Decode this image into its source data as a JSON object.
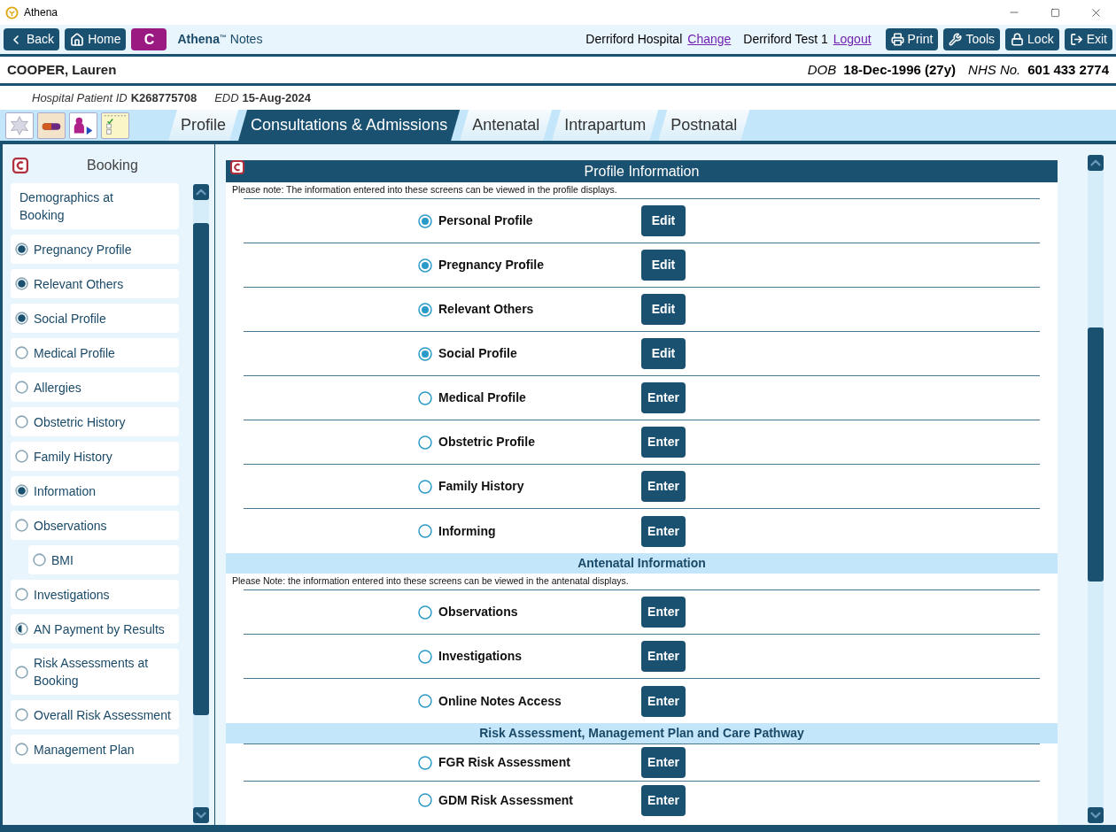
{
  "window": {
    "title": "Athena"
  },
  "toolbar": {
    "left_buttons": [
      {
        "kind": "back",
        "label": "Back"
      },
      {
        "kind": "home",
        "label": "Home"
      },
      {
        "kind": "badge",
        "label": "C"
      }
    ],
    "app_name": "Athena",
    "app_mark": "™",
    "app_suffix": "Notes",
    "hospital": "Derriford Hospital",
    "change_link": "Change",
    "user": "Derriford Test 1",
    "logout_link": "Logout",
    "right_buttons": [
      {
        "kind": "print",
        "label": "Print"
      },
      {
        "kind": "tools",
        "label": "Tools"
      },
      {
        "kind": "lock",
        "label": "Lock"
      },
      {
        "kind": "exit",
        "label": "Exit"
      }
    ]
  },
  "patient": {
    "name": "COOPER, Lauren",
    "dob_label": "DOB",
    "dob": "18-Dec-1996 (27y)",
    "nhs_label": "NHS No.",
    "nhs": "601 433 2774",
    "id_label": "Hospital Patient ID",
    "id": "K268775708",
    "edd_label": "EDD",
    "edd": "15-Aug-2024"
  },
  "tool_icons": [
    {
      "kind": "star"
    },
    {
      "kind": "pill"
    },
    {
      "kind": "person"
    },
    {
      "kind": "note"
    }
  ],
  "tabs": [
    {
      "label": "Profile",
      "selected": false
    },
    {
      "label": "Consultations & Admissions",
      "selected": true
    },
    {
      "label": "Antenatal",
      "selected": false
    },
    {
      "label": "Intrapartum",
      "selected": false
    },
    {
      "label": "Postnatal",
      "selected": false
    }
  ],
  "sidebar": {
    "title": "Booking",
    "items": [
      {
        "label": "Demographics at Booking",
        "kind": "plain"
      },
      {
        "label": "Pregnancy Profile",
        "kind": "radio",
        "checked": true,
        "partial": false
      },
      {
        "label": "Relevant Others",
        "kind": "radio",
        "checked": true,
        "partial": false
      },
      {
        "label": "Social Profile",
        "kind": "radio",
        "checked": true,
        "partial": false
      },
      {
        "label": "Medical Profile",
        "kind": "radio",
        "checked": false,
        "partial": false
      },
      {
        "label": "Allergies",
        "kind": "radio",
        "checked": false,
        "partial": false
      },
      {
        "label": "Obstetric History",
        "kind": "radio",
        "checked": false,
        "partial": false
      },
      {
        "label": "Family History",
        "kind": "radio",
        "checked": false,
        "partial": false
      },
      {
        "label": "Information",
        "kind": "radio",
        "checked": true,
        "partial": false
      },
      {
        "label": "Observations",
        "kind": "radio",
        "checked": false,
        "partial": false,
        "children": [
          {
            "label": "BMI",
            "kind": "radio",
            "checked": false,
            "partial": false
          }
        ]
      },
      {
        "label": "Investigations",
        "kind": "radio",
        "checked": false,
        "partial": false
      },
      {
        "label": "AN Payment by Results",
        "kind": "radio",
        "checked": false,
        "partial": true
      },
      {
        "label": "Risk Assessments at Booking",
        "kind": "radio",
        "checked": false,
        "partial": false
      },
      {
        "label": "Overall Risk Assessment",
        "kind": "radio",
        "checked": false,
        "partial": false
      },
      {
        "label": "Management Plan",
        "kind": "radio",
        "checked": false,
        "partial": false
      }
    ]
  },
  "sections": [
    {
      "title": "Profile Information",
      "kind": "primary",
      "note": "Please note: The information entered into these screens can be viewed in the profile displays.",
      "rows": [
        {
          "label": "Personal Profile",
          "checked": true,
          "button": "Edit"
        },
        {
          "label": "Pregnancy Profile",
          "checked": true,
          "button": "Edit"
        },
        {
          "label": "Relevant Others",
          "checked": true,
          "button": "Edit"
        },
        {
          "label": "Social Profile",
          "checked": true,
          "button": "Edit"
        },
        {
          "label": "Medical Profile",
          "checked": false,
          "button": "Enter"
        },
        {
          "label": "Obstetric Profile",
          "checked": false,
          "button": "Enter"
        },
        {
          "label": "Family History",
          "checked": false,
          "button": "Enter"
        },
        {
          "label": "Informing",
          "checked": false,
          "button": "Enter"
        }
      ]
    },
    {
      "title": "Antenatal Information",
      "kind": "secondary",
      "note": "Please Note: the information entered into these screens can be viewed in the antenatal displays.",
      "rows": [
        {
          "label": "Observations",
          "checked": false,
          "button": "Enter"
        },
        {
          "label": "Investigations",
          "checked": false,
          "button": "Enter"
        },
        {
          "label": "Online Notes Access",
          "checked": false,
          "button": "Enter"
        }
      ]
    },
    {
      "title": "Risk Assessment, Management Plan and Care Pathway",
      "kind": "secondary",
      "rows": [
        {
          "label": "FGR Risk Assessment",
          "checked": false,
          "button": "Enter"
        },
        {
          "label": "GDM Risk Assessment",
          "checked": false,
          "button": "Enter"
        }
      ]
    }
  ]
}
